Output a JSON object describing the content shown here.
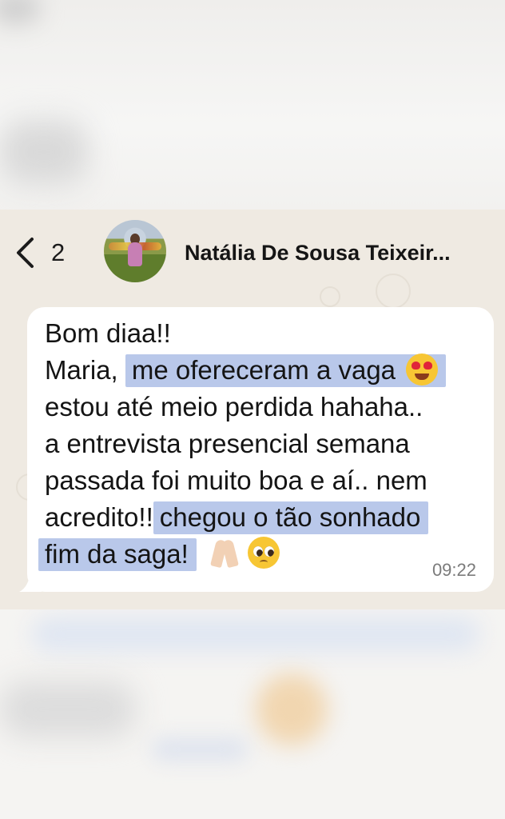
{
  "header": {
    "back_count": "2",
    "contact_name": "Natália De Sousa Teixeir..."
  },
  "message": {
    "greeting": "Bom diaa!!",
    "line2_prefix": "Maria,",
    "line2_highlight": "me ofereceram a vaga",
    "line3": "estou até meio perdida hahaha..",
    "line4": "a entrevista presencial semana",
    "line5": "passada foi muito boa e aí.. nem",
    "line6_prefix": "acredito!!",
    "line6_highlight": "chegou o tão sonhado",
    "line7_highlight": "fim da saga!",
    "time": "09:22",
    "emojis": [
      "heart-eyes-emoji",
      "praying-hands-emoji",
      "pleading-face-emoji"
    ]
  },
  "colors": {
    "chat_background": "#efeae2",
    "bubble": "#ffffff",
    "highlight": "#b9c8ea",
    "timestamp": "#7b7b7b"
  }
}
